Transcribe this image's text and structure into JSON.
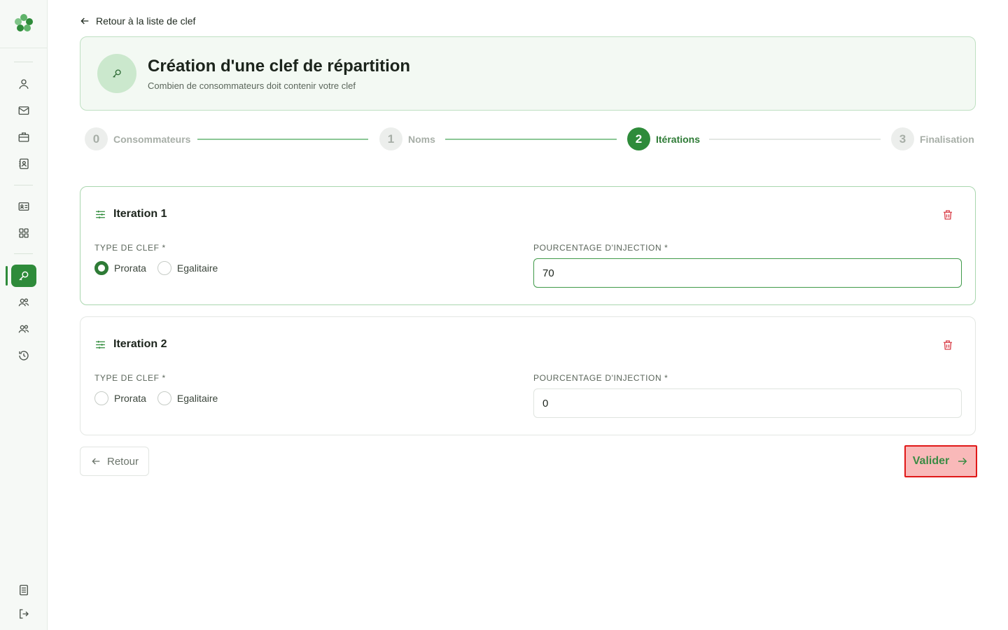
{
  "nav": {
    "back_label": "Retour à la liste de clef"
  },
  "header": {
    "title": "Création d'une clef de répartition",
    "subtitle": "Combien de consommateurs doit contenir votre clef"
  },
  "stepper": {
    "steps": [
      {
        "number": "0",
        "label": "Consommateurs",
        "state": "completed"
      },
      {
        "number": "1",
        "label": "Noms",
        "state": "completed"
      },
      {
        "number": "2",
        "label": "Itérations",
        "state": "active"
      },
      {
        "number": "3",
        "label": "Finalisation",
        "state": "pending"
      }
    ]
  },
  "iterations": [
    {
      "title": "Iteration 1",
      "type_label": "TYPE DE CLEF *",
      "options": [
        "Prorata",
        "Egalitaire"
      ],
      "selected": "Prorata",
      "percent_label": "POURCENTAGE D'INJECTION *",
      "percent_value": "70"
    },
    {
      "title": "Iteration 2",
      "type_label": "TYPE DE CLEF *",
      "options": [
        "Prorata",
        "Egalitaire"
      ],
      "selected": "",
      "percent_label": "POURCENTAGE D'INJECTION *",
      "percent_value": "0"
    }
  ],
  "actions": {
    "back_label": "Retour",
    "validate_label": "Valider"
  },
  "colors": {
    "accent": "#2e8b3a",
    "danger": "#d9404a",
    "highlight": "#e01818"
  }
}
